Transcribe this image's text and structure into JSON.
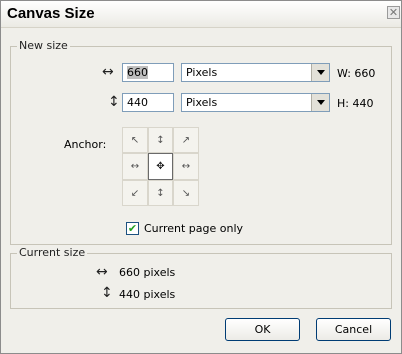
{
  "dialog": {
    "title": "Canvas Size",
    "close_glyph": "✕"
  },
  "new_size": {
    "legend": "New size",
    "width": {
      "icon": "horizontal-arrow-icon",
      "value": "660",
      "unit": "Pixels",
      "readout": "W: 660"
    },
    "height": {
      "icon": "vertical-arrow-icon",
      "value": "440",
      "unit": "Pixels",
      "readout": "H: 440"
    }
  },
  "anchor": {
    "label": "Anchor:",
    "selected": "center",
    "cells": [
      "↖",
      "↕",
      "↗",
      "↔",
      "✥",
      "↔",
      "↙",
      "↕",
      "↘"
    ]
  },
  "current_page_only": {
    "label": "Current page only",
    "checked": true
  },
  "current_size": {
    "legend": "Current size",
    "width_text": "660 pixels",
    "height_text": "440 pixels"
  },
  "buttons": {
    "ok": "OK",
    "cancel": "Cancel"
  },
  "glyphs": {
    "horizontal_arrow": "↔",
    "vertical_arrow": "↕",
    "check": "✔"
  }
}
